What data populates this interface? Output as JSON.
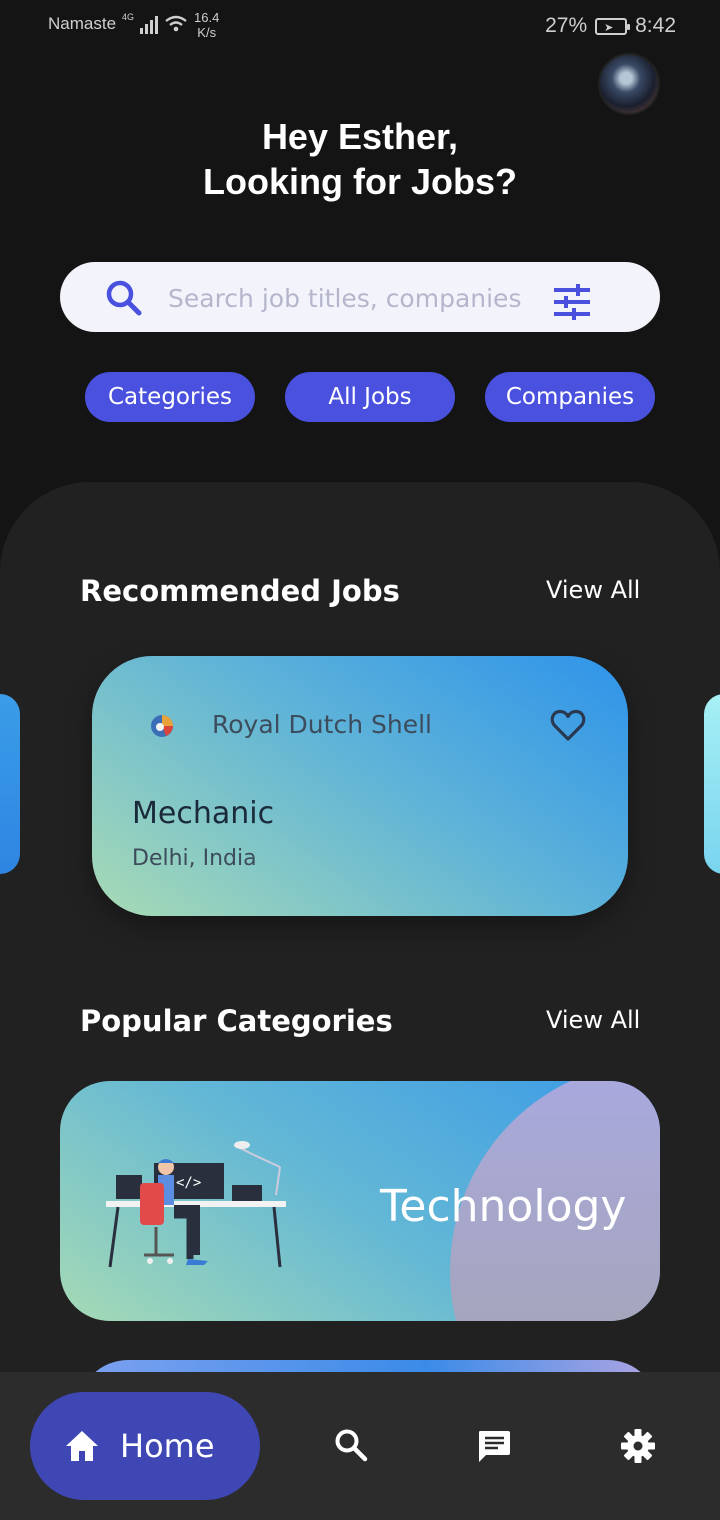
{
  "status_bar": {
    "carrier": "Namaste",
    "network": "4G",
    "speed_value": "16.4",
    "speed_unit": "K/s",
    "battery": "27%",
    "time": "8:42"
  },
  "greeting": {
    "line1": "Hey Esther,",
    "line2": "Looking for Jobs?"
  },
  "search": {
    "placeholder": "Search job titles, companies"
  },
  "chips": [
    "Categories",
    "All Jobs",
    "Companies"
  ],
  "recommended": {
    "title": "Recommended Jobs",
    "view_all": "View All",
    "job": {
      "company": "Royal Dutch Shell",
      "title": "Mechanic",
      "location": "Delhi, India"
    }
  },
  "categories": {
    "title": "Popular Categories",
    "view_all": "View All",
    "items": [
      "Technology"
    ]
  },
  "nav": {
    "home": "Home",
    "icons": [
      "home-icon",
      "search-icon",
      "chat-icon",
      "settings-icon"
    ]
  },
  "colors": {
    "accent": "#4a51de",
    "nav_active": "#3f47b4",
    "panel": "#212121"
  }
}
